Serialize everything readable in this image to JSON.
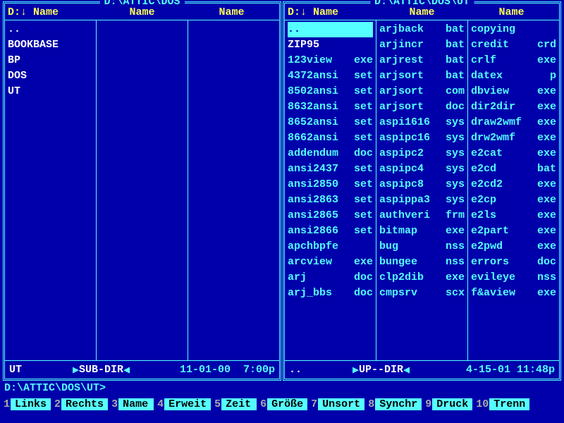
{
  "left": {
    "title": "D:\\ATTIC\\DOS",
    "header_prefix": "D:↓ ",
    "header_label": "Name",
    "columns": [
      {
        "rows": [
          {
            "name": "..",
            "ext": "",
            "dir": true
          },
          {
            "name": "BOOKBASE",
            "ext": "",
            "dir": true
          },
          {
            "name": "BP",
            "ext": "",
            "dir": true
          },
          {
            "name": "DOS",
            "ext": "",
            "dir": true
          },
          {
            "name": "UT",
            "ext": "",
            "dir": true
          }
        ]
      },
      {
        "rows": []
      },
      {
        "rows": []
      }
    ],
    "footer": {
      "name": "UT",
      "arrow_l": "▶",
      "tag": "SUB-DIR",
      "arrow_r": "◀",
      "date": "11-01-00",
      "time": "7:00p"
    }
  },
  "right": {
    "title": "D:\\ATTIC\\DOS\\UT",
    "header_prefix": "D:↓ ",
    "header_label": "Name",
    "columns": [
      {
        "rows": [
          {
            "name": "..",
            "ext": "",
            "dir": true,
            "selected": true
          },
          {
            "name": "ZIP95",
            "ext": "",
            "dir": true
          },
          {
            "name": "123view",
            "ext": "exe"
          },
          {
            "name": "4372ansi",
            "ext": "set"
          },
          {
            "name": "8502ansi",
            "ext": "set"
          },
          {
            "name": "8632ansi",
            "ext": "set"
          },
          {
            "name": "8652ansi",
            "ext": "set"
          },
          {
            "name": "8662ansi",
            "ext": "set"
          },
          {
            "name": "addendum",
            "ext": "doc"
          },
          {
            "name": "ansi2437",
            "ext": "set"
          },
          {
            "name": "ansi2850",
            "ext": "set"
          },
          {
            "name": "ansi2863",
            "ext": "set"
          },
          {
            "name": "ansi2865",
            "ext": "set"
          },
          {
            "name": "ansi2866",
            "ext": "set"
          },
          {
            "name": "apchbpfe",
            "ext": ""
          },
          {
            "name": "arcview",
            "ext": "exe"
          },
          {
            "name": "arj",
            "ext": "doc"
          },
          {
            "name": "arj_bbs",
            "ext": "doc"
          }
        ]
      },
      {
        "rows": [
          {
            "name": "arjback",
            "ext": "bat"
          },
          {
            "name": "arjincr",
            "ext": "bat"
          },
          {
            "name": "arjrest",
            "ext": "bat"
          },
          {
            "name": "arjsort",
            "ext": "bat"
          },
          {
            "name": "arjsort",
            "ext": "com"
          },
          {
            "name": "arjsort",
            "ext": "doc"
          },
          {
            "name": "aspi1616",
            "ext": "sys"
          },
          {
            "name": "aspipc16",
            "ext": "sys"
          },
          {
            "name": "aspipc2",
            "ext": "sys"
          },
          {
            "name": "aspipc4",
            "ext": "sys"
          },
          {
            "name": "aspipc8",
            "ext": "sys"
          },
          {
            "name": "aspippa3",
            "ext": "sys"
          },
          {
            "name": "authveri",
            "ext": "frm"
          },
          {
            "name": "bitmap",
            "ext": "exe"
          },
          {
            "name": "bug",
            "ext": "nss"
          },
          {
            "name": "bungee",
            "ext": "nss"
          },
          {
            "name": "clp2dib",
            "ext": "exe"
          },
          {
            "name": "cmpsrv",
            "ext": "scx"
          }
        ]
      },
      {
        "rows": [
          {
            "name": "copying",
            "ext": ""
          },
          {
            "name": "credit",
            "ext": "crd"
          },
          {
            "name": "crlf",
            "ext": "exe"
          },
          {
            "name": "datex",
            "ext": "p"
          },
          {
            "name": "dbview",
            "ext": "exe"
          },
          {
            "name": "dir2dir",
            "ext": "exe"
          },
          {
            "name": "draw2wmf",
            "ext": "exe"
          },
          {
            "name": "drw2wmf",
            "ext": "exe"
          },
          {
            "name": "e2cat",
            "ext": "exe"
          },
          {
            "name": "e2cd",
            "ext": "bat"
          },
          {
            "name": "e2cd2",
            "ext": "exe"
          },
          {
            "name": "e2cp",
            "ext": "exe"
          },
          {
            "name": "e2ls",
            "ext": "exe"
          },
          {
            "name": "e2part",
            "ext": "exe"
          },
          {
            "name": "e2pwd",
            "ext": "exe"
          },
          {
            "name": "errors",
            "ext": "doc"
          },
          {
            "name": "evileye",
            "ext": "nss"
          },
          {
            "name": "f&aview",
            "ext": "exe"
          }
        ]
      }
    ],
    "footer": {
      "name": "..",
      "arrow_l": "▶",
      "tag": "UP--DIR",
      "arrow_r": "◀",
      "date": "4-15-01",
      "time": "11:48p"
    }
  },
  "cmdline": "D:\\ATTIC\\DOS\\UT>",
  "fkeys": [
    {
      "num": "1",
      "label": "Links"
    },
    {
      "num": "2",
      "label": "Rechts"
    },
    {
      "num": "3",
      "label": "Name"
    },
    {
      "num": "4",
      "label": "Erweit"
    },
    {
      "num": "5",
      "label": "Zeit"
    },
    {
      "num": "6",
      "label": "Größe"
    },
    {
      "num": "7",
      "label": "Unsort"
    },
    {
      "num": "8",
      "label": "Synchr"
    },
    {
      "num": "9",
      "label": "Druck"
    },
    {
      "num": "10",
      "label": "Trenn"
    }
  ]
}
